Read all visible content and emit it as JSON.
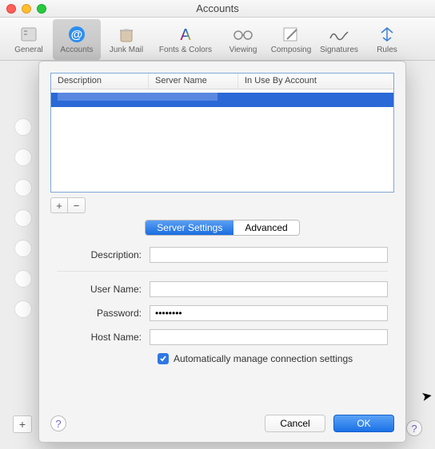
{
  "window": {
    "title": "Accounts"
  },
  "toolbar": {
    "items": [
      {
        "label": "General"
      },
      {
        "label": "Accounts"
      },
      {
        "label": "Junk Mail"
      },
      {
        "label": "Fonts & Colors"
      },
      {
        "label": "Viewing"
      },
      {
        "label": "Composing"
      },
      {
        "label": "Signatures"
      },
      {
        "label": "Rules"
      }
    ],
    "active_index": 1
  },
  "table": {
    "columns": [
      "Description",
      "Server Name",
      "In Use By Account"
    ],
    "rows": [
      {
        "description": "",
        "server": "",
        "account": "",
        "selected": true
      }
    ]
  },
  "addremove": {
    "add": "+",
    "remove": "−"
  },
  "tabs": {
    "server": "Server Settings",
    "advanced": "Advanced",
    "active": "server"
  },
  "form": {
    "description_label": "Description:",
    "description_value": "",
    "username_label": "User Name:",
    "username_value": "",
    "password_label": "Password:",
    "password_value": "••••••••",
    "hostname_label": "Host Name:",
    "hostname_value": "",
    "auto_label": "Automatically manage connection settings",
    "auto_checked": true
  },
  "footer": {
    "help": "?",
    "cancel": "Cancel",
    "ok": "OK"
  },
  "parent": {
    "add": "+",
    "help": "?"
  }
}
